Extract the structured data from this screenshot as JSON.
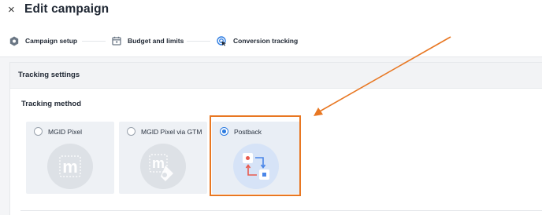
{
  "header": {
    "close_glyph": "×",
    "title": "Edit campaign"
  },
  "steps": [
    {
      "label": "Campaign setup",
      "icon": "hexagon-settings-icon"
    },
    {
      "label": "Budget and limits",
      "icon": "calendar-icon"
    },
    {
      "label": "Conversion tracking",
      "icon": "target-cursor-icon"
    }
  ],
  "tracking": {
    "card_title": "Tracking settings",
    "method_label": "Tracking method",
    "options": [
      {
        "label": "MGID Pixel",
        "selected": false,
        "icon": "mgid-pixel-icon"
      },
      {
        "label": "MGID Pixel via GTM",
        "selected": false,
        "icon": "mgid-gtm-icon"
      },
      {
        "label": "Postback",
        "selected": true,
        "icon": "postback-icon"
      }
    ]
  },
  "colors": {
    "accent": "#2f7de1",
    "highlight": "#e87722",
    "page_bg": "#f4f5f7"
  }
}
